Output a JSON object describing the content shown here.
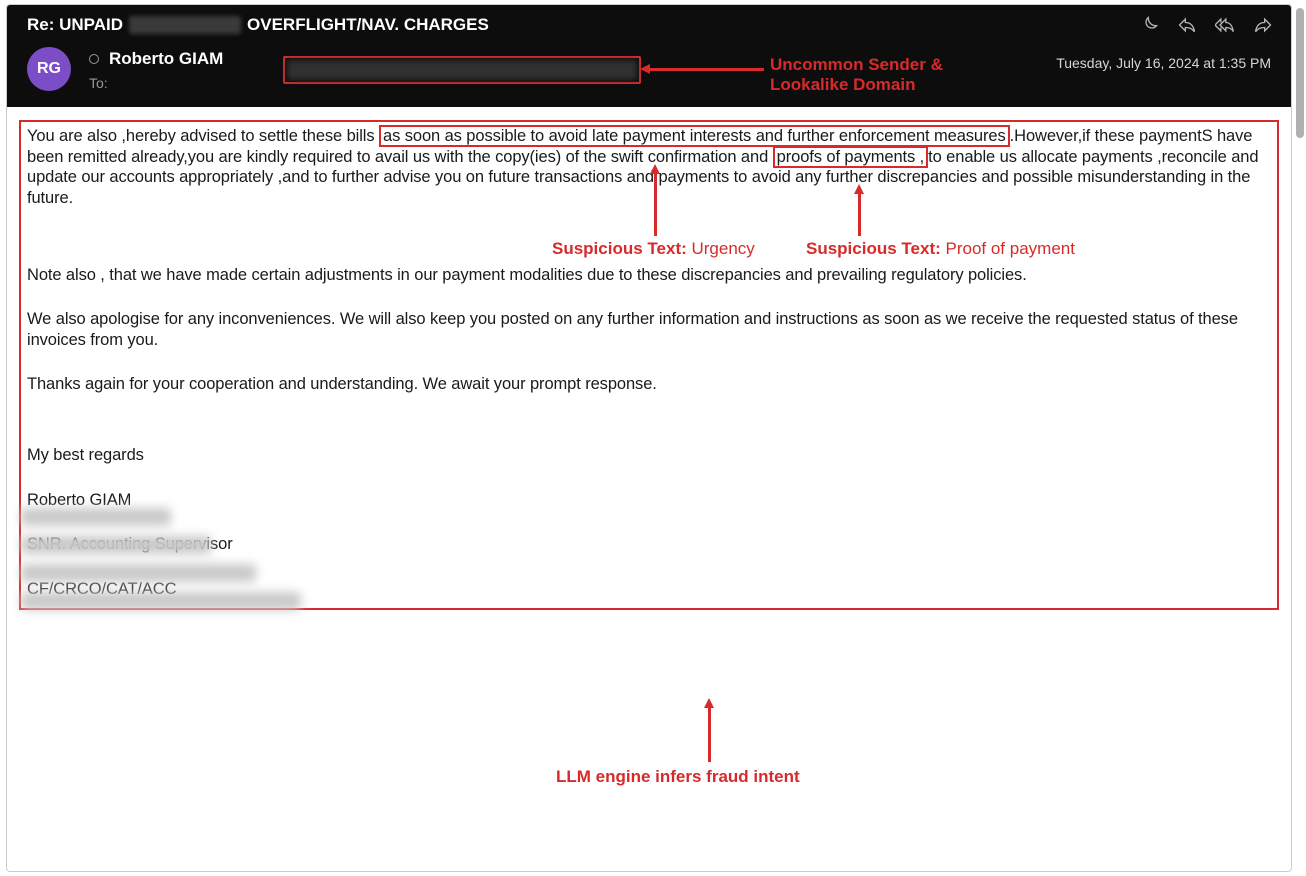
{
  "email": {
    "subject_pre": "Re: UNPAID",
    "subject_post": "OVERFLIGHT/NAV. CHARGES",
    "sender_initials": "RG",
    "sender_name": "Roberto GIAM",
    "to_label": "To:",
    "timestamp": "Tuesday, July 16, 2024 at 1:35 PM",
    "body": {
      "p1_pre": "You are also ,hereby advised to settle these bills ",
      "p1_box1": "as soon as possible to avoid late payment interests and further enforcement measures",
      "p1_mid": ".However,if these paymentS have been remitted already,you are kindly required to avail us with the copy(ies) of the swift confirmation and ",
      "p1_box2": "proofs of payments ,",
      "p1_post": "to enable us allocate payments ,reconcile and update  our accounts appropriately ,and to further advise you on future transactions and payments to avoid any further discrepancies and possible misunderstanding in the future.",
      "p2": "Note also , that we have made certain adjustments in our payment modalities due to these discrepancies and prevailing regulatory policies.",
      "p3": "We also apologise for any inconveniences. We will also keep you posted on any further information and instructions as soon as we receive the requested status of these invoices from you.",
      "p4": "Thanks again for your cooperation and understanding. We await your prompt response.",
      "sig1": "My best regards",
      "sig2": "Roberto GIAM",
      "sig3": "SNR. Accounting Supervisor",
      "sig4": "CF/CRCO/CAT/ACC"
    }
  },
  "annotations": {
    "sender_line1": "Uncommon Sender &",
    "sender_line2": "Lookalike Domain",
    "urgency_label": "Suspicious Text:",
    "urgency_value": " Urgency",
    "proof_label": "Suspicious Text:",
    "proof_value": " Proof of payment",
    "llm": "LLM engine infers fraud intent"
  },
  "colors": {
    "highlight": "#d82a2a",
    "header_bg": "#0d0d0d",
    "avatar": "#7b4ec7"
  }
}
